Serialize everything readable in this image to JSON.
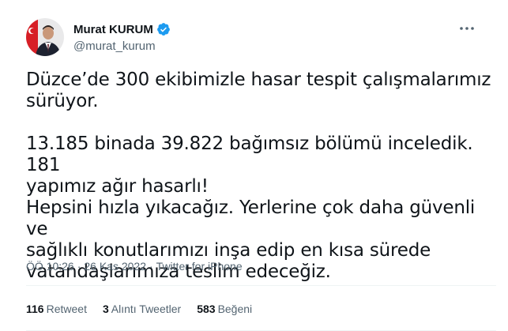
{
  "author": {
    "display_name": "Murat KURUM",
    "handle": "@murat_kurum",
    "avatar_icon": "profile-photo",
    "verified_icon": "verified-badge-icon",
    "verified_color": "#1d9bf0"
  },
  "more_icon": "more-dots-icon",
  "tweet": {
    "text": "Düzce’de 300 ekibimizle hasar tespit çalışmalarımız\nsürüyor.\n\n13.185 binada 39.822 bağımsız bölümü inceledik. 181\nyapımız ağır hasarlı!\nHepsini hızla yıkacağız. Yerlerine çok daha güvenli ve\nsağlıklı konutlarımızı inşa edip en kısa sürede\nvatandaşlarımıza teslim edeceğiz."
  },
  "meta": {
    "time": "ÖÖ 10:26",
    "separator": "·",
    "date": "26 Kas 2022",
    "source": "Twitter for iPhone"
  },
  "stats": {
    "retweets_count": "116",
    "retweets_label": "Retweet",
    "quotes_count": "3",
    "quotes_label": "Alıntı Tweetler",
    "likes_count": "583",
    "likes_label": "Beğeni"
  },
  "colors": {
    "text_primary": "#0f1419",
    "text_secondary": "#536471",
    "divider": "#eff3f4"
  }
}
